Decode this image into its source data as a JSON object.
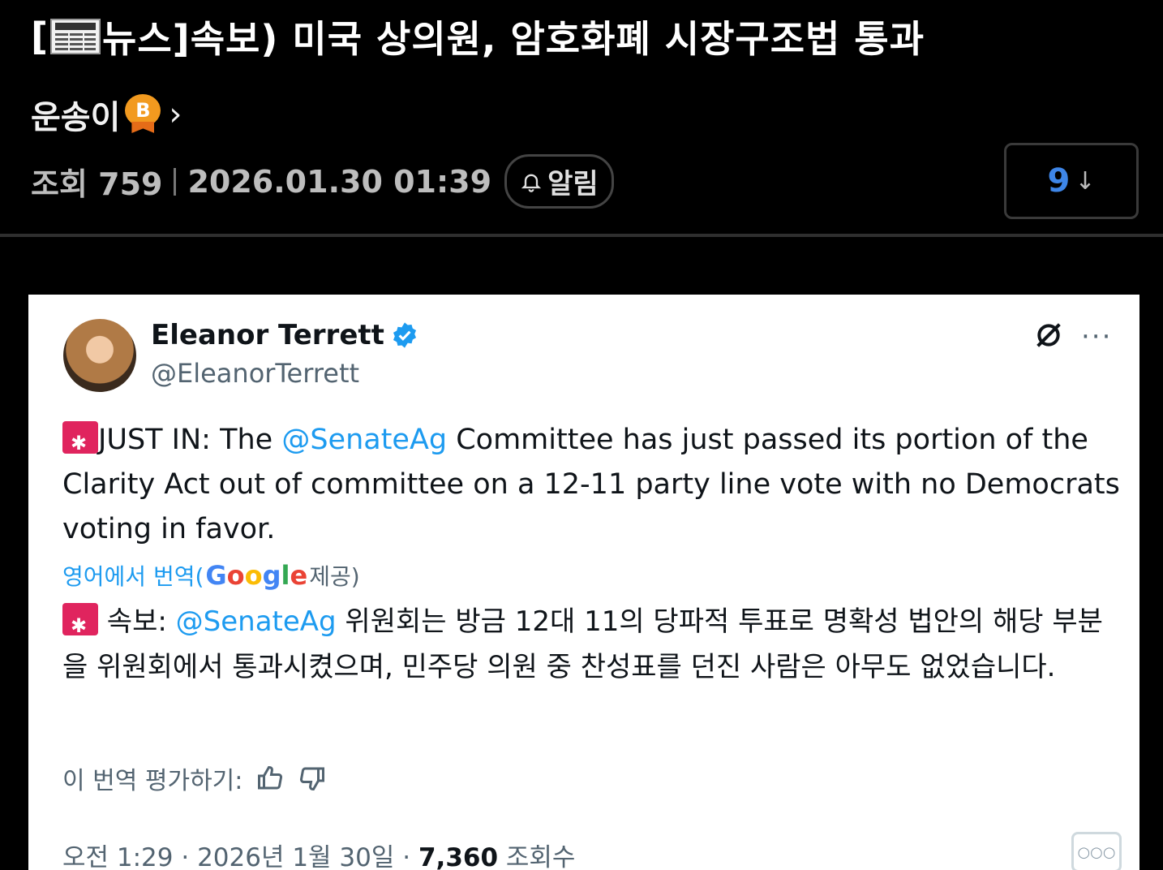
{
  "post": {
    "title_prefix": "[",
    "title_tag": "뉴스]",
    "title_main": " 속보) 미국 상의원, 암호화폐 시장구조법 통과",
    "author": "운송이",
    "badge_letter": "B",
    "views_label": "조회 759",
    "datetime": "2026.01.30 01:39",
    "alarm_label": "알림",
    "reply_count": "9",
    "reply_arrow": "↓"
  },
  "tweet": {
    "name": "Eleanor Terrett",
    "handle": "@EleanorTerrett",
    "text_en_1": "JUST IN: The ",
    "mention": "@SenateAg",
    "text_en_2": " Committee has just passed its portion of the Clarity Act out of committee on a 12-11 party line vote with no Democrats voting in favor.",
    "translate_label": "영어에서 번역(",
    "google": [
      "G",
      "o",
      "o",
      "g",
      "l",
      "e"
    ],
    "provided_label": " 제공)",
    "text_ko_1": " 속보: ",
    "text_ko_2": " 위원회는 방금 12대 11의 당파적 투표로 명확성 법안의 해당 부분을 위원회에서 통과시켰으며, 민주당 의원 중 찬성표를 던진 사람은 아무도 없었습니다.",
    "rate_label": "이 번역 평가하기:",
    "timestamp": "오전 1:29 · 2026년 1월 30일 · ",
    "views_num": "7,360",
    "views_label": " 조회수",
    "more_label": "···"
  },
  "colors": {
    "background": "#000000",
    "accent_blue": "#1d9bf0",
    "reply_blue": "#3e86e8",
    "badge_orange": "#f29a1f",
    "siren_red": "#e0245e"
  }
}
